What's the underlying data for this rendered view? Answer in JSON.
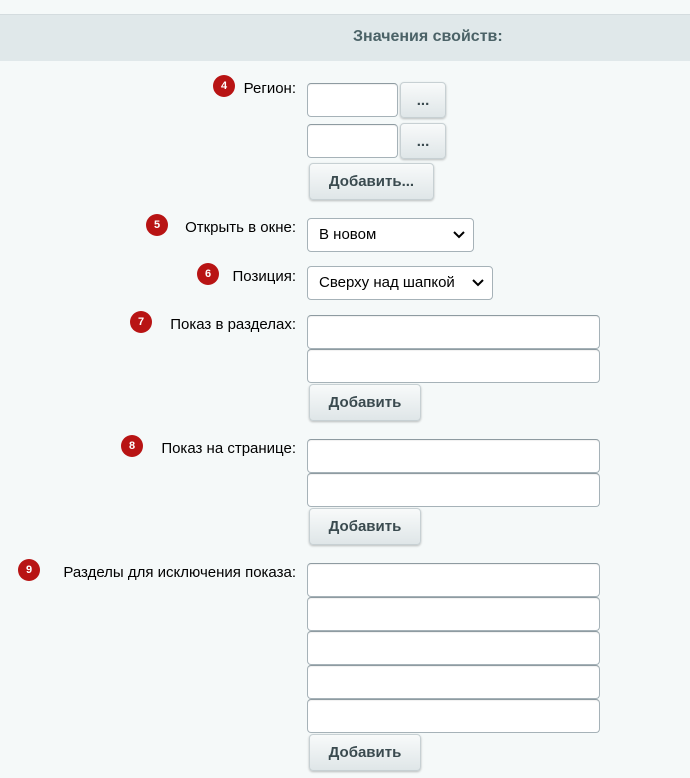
{
  "header": {
    "title": "Значения свойств:"
  },
  "fields": {
    "region": {
      "number": "4",
      "label": "Регион:",
      "browse_button": "...",
      "add_button": "Добавить...",
      "values": [
        "",
        ""
      ]
    },
    "open_in_window": {
      "number": "5",
      "label": "Открыть в окне:",
      "selected": "В новом"
    },
    "position": {
      "number": "6",
      "label": "Позиция:",
      "selected": "Сверху над шапкой"
    },
    "show_in_sections": {
      "number": "7",
      "label": "Показ в разделах:",
      "add_button": "Добавить",
      "values": [
        "",
        ""
      ]
    },
    "show_on_page": {
      "number": "8",
      "label": "Показ на странице:",
      "add_button": "Добавить",
      "values": [
        "",
        ""
      ]
    },
    "exclude_sections": {
      "number": "9",
      "label": "Разделы для исключения показа:",
      "add_button": "Добавить",
      "values": [
        "",
        "",
        "",
        "",
        ""
      ]
    }
  },
  "colors": {
    "badge": "#b81414",
    "header_bg": "#e0e8ea",
    "header_text": "#4b6267"
  }
}
